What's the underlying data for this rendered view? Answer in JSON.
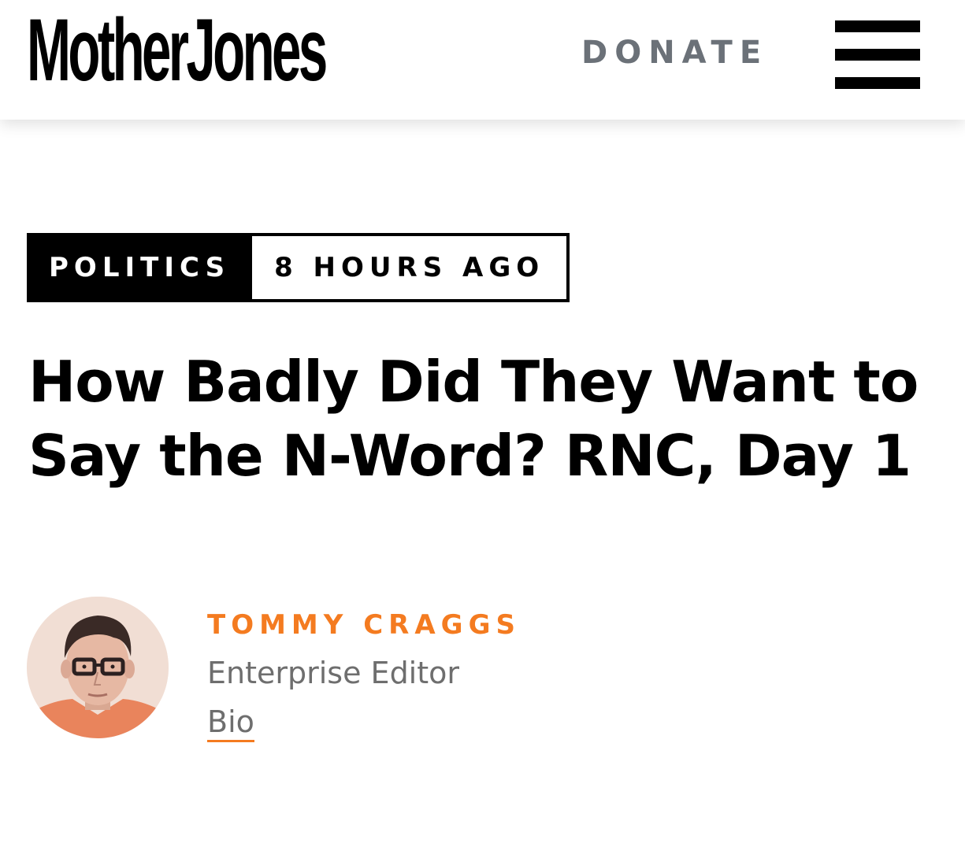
{
  "header": {
    "logo_text": "MotherJones",
    "donate_label": "DONATE",
    "menu_icon": "hamburger-menu-icon"
  },
  "article": {
    "category": "POLITICS",
    "timestamp": "8 HOURS AGO",
    "headline": "How Badly Did They Want to Say the N-Word? RNC, Day 1"
  },
  "byline": {
    "author_name": "TOMMY CRAGGS",
    "author_title": "Enterprise Editor",
    "bio_label": "Bio"
  },
  "colors": {
    "accent": "#f47b20",
    "donate_text": "#6b7178",
    "secondary_text": "#6e6e6e",
    "primary_text": "#000000",
    "background": "#ffffff"
  }
}
